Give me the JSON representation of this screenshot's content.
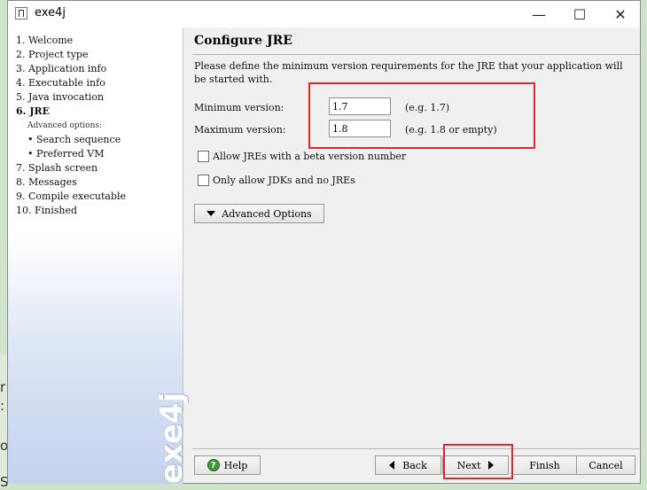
{
  "window": {
    "title": "exe4j",
    "minimize_glyph": "—",
    "maximize_glyph": "☐",
    "close_glyph": "✕"
  },
  "background": {
    "fragments": [
      "r",
      ":",
      "o",
      "S"
    ]
  },
  "sidebar": {
    "steps": [
      "1.  Welcome",
      "2.  Project type",
      "3.  Application info",
      "4.  Executable info",
      "5.  Java invocation",
      "6.  JRE",
      "Advanced options:",
      "• Search sequence",
      "• Preferred VM",
      "7.  Splash screen",
      "8.  Messages",
      "9.  Compile executable",
      "10.  Finished"
    ],
    "brand": "exe4j"
  },
  "main": {
    "title": "Configure JRE",
    "description": "Please define the minimum version requirements for the JRE that your application will be started with.",
    "min_label": "Minimum version:",
    "min_value": "1.7",
    "min_hint": "(e.g. 1.7)",
    "max_label": "Maximum version:",
    "max_value": "1.8",
    "max_hint": "(e.g. 1.8 or empty)",
    "beta_label": "Allow JREs with a beta version number",
    "jdk_label": "Only allow JDKs and no JREs",
    "advanced_label": "Advanced Options"
  },
  "footer": {
    "help": "Help",
    "back": "Back",
    "next": "Next",
    "finish": "Finish",
    "cancel": "Cancel"
  },
  "colors": {
    "highlight": "#e02828",
    "help_icon": "#3a9a3a"
  }
}
